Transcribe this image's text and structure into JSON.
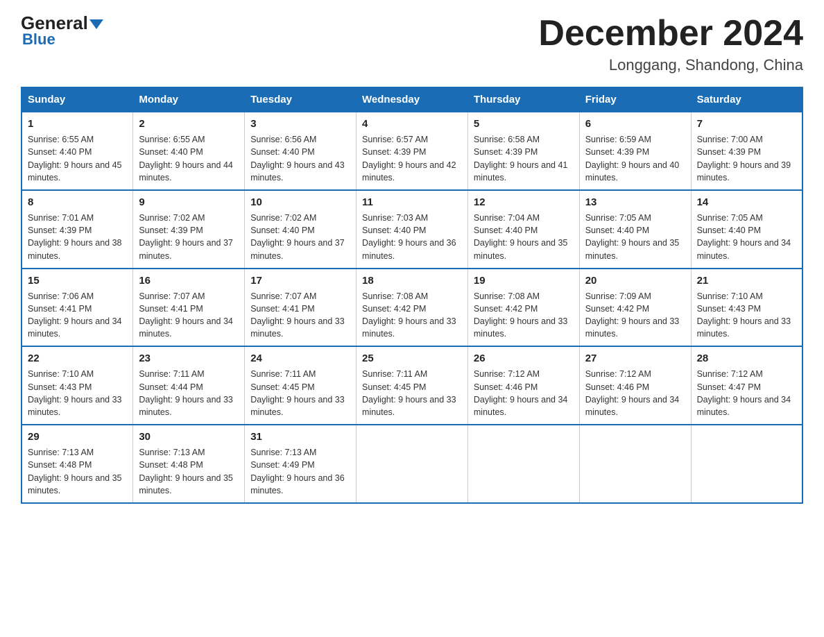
{
  "logo": {
    "general": "General",
    "blue": "Blue",
    "subtitle": "Blue"
  },
  "header": {
    "title": "December 2024",
    "location": "Longgang, Shandong, China"
  },
  "weekdays": [
    "Sunday",
    "Monday",
    "Tuesday",
    "Wednesday",
    "Thursday",
    "Friday",
    "Saturday"
  ],
  "weeks": [
    [
      {
        "day": "1",
        "sunrise": "6:55 AM",
        "sunset": "4:40 PM",
        "daylight": "9 hours and 45 minutes."
      },
      {
        "day": "2",
        "sunrise": "6:55 AM",
        "sunset": "4:40 PM",
        "daylight": "9 hours and 44 minutes."
      },
      {
        "day": "3",
        "sunrise": "6:56 AM",
        "sunset": "4:40 PM",
        "daylight": "9 hours and 43 minutes."
      },
      {
        "day": "4",
        "sunrise": "6:57 AM",
        "sunset": "4:39 PM",
        "daylight": "9 hours and 42 minutes."
      },
      {
        "day": "5",
        "sunrise": "6:58 AM",
        "sunset": "4:39 PM",
        "daylight": "9 hours and 41 minutes."
      },
      {
        "day": "6",
        "sunrise": "6:59 AM",
        "sunset": "4:39 PM",
        "daylight": "9 hours and 40 minutes."
      },
      {
        "day": "7",
        "sunrise": "7:00 AM",
        "sunset": "4:39 PM",
        "daylight": "9 hours and 39 minutes."
      }
    ],
    [
      {
        "day": "8",
        "sunrise": "7:01 AM",
        "sunset": "4:39 PM",
        "daylight": "9 hours and 38 minutes."
      },
      {
        "day": "9",
        "sunrise": "7:02 AM",
        "sunset": "4:39 PM",
        "daylight": "9 hours and 37 minutes."
      },
      {
        "day": "10",
        "sunrise": "7:02 AM",
        "sunset": "4:40 PM",
        "daylight": "9 hours and 37 minutes."
      },
      {
        "day": "11",
        "sunrise": "7:03 AM",
        "sunset": "4:40 PM",
        "daylight": "9 hours and 36 minutes."
      },
      {
        "day": "12",
        "sunrise": "7:04 AM",
        "sunset": "4:40 PM",
        "daylight": "9 hours and 35 minutes."
      },
      {
        "day": "13",
        "sunrise": "7:05 AM",
        "sunset": "4:40 PM",
        "daylight": "9 hours and 35 minutes."
      },
      {
        "day": "14",
        "sunrise": "7:05 AM",
        "sunset": "4:40 PM",
        "daylight": "9 hours and 34 minutes."
      }
    ],
    [
      {
        "day": "15",
        "sunrise": "7:06 AM",
        "sunset": "4:41 PM",
        "daylight": "9 hours and 34 minutes."
      },
      {
        "day": "16",
        "sunrise": "7:07 AM",
        "sunset": "4:41 PM",
        "daylight": "9 hours and 34 minutes."
      },
      {
        "day": "17",
        "sunrise": "7:07 AM",
        "sunset": "4:41 PM",
        "daylight": "9 hours and 33 minutes."
      },
      {
        "day": "18",
        "sunrise": "7:08 AM",
        "sunset": "4:42 PM",
        "daylight": "9 hours and 33 minutes."
      },
      {
        "day": "19",
        "sunrise": "7:08 AM",
        "sunset": "4:42 PM",
        "daylight": "9 hours and 33 minutes."
      },
      {
        "day": "20",
        "sunrise": "7:09 AM",
        "sunset": "4:42 PM",
        "daylight": "9 hours and 33 minutes."
      },
      {
        "day": "21",
        "sunrise": "7:10 AM",
        "sunset": "4:43 PM",
        "daylight": "9 hours and 33 minutes."
      }
    ],
    [
      {
        "day": "22",
        "sunrise": "7:10 AM",
        "sunset": "4:43 PM",
        "daylight": "9 hours and 33 minutes."
      },
      {
        "day": "23",
        "sunrise": "7:11 AM",
        "sunset": "4:44 PM",
        "daylight": "9 hours and 33 minutes."
      },
      {
        "day": "24",
        "sunrise": "7:11 AM",
        "sunset": "4:45 PM",
        "daylight": "9 hours and 33 minutes."
      },
      {
        "day": "25",
        "sunrise": "7:11 AM",
        "sunset": "4:45 PM",
        "daylight": "9 hours and 33 minutes."
      },
      {
        "day": "26",
        "sunrise": "7:12 AM",
        "sunset": "4:46 PM",
        "daylight": "9 hours and 34 minutes."
      },
      {
        "day": "27",
        "sunrise": "7:12 AM",
        "sunset": "4:46 PM",
        "daylight": "9 hours and 34 minutes."
      },
      {
        "day": "28",
        "sunrise": "7:12 AM",
        "sunset": "4:47 PM",
        "daylight": "9 hours and 34 minutes."
      }
    ],
    [
      {
        "day": "29",
        "sunrise": "7:13 AM",
        "sunset": "4:48 PM",
        "daylight": "9 hours and 35 minutes."
      },
      {
        "day": "30",
        "sunrise": "7:13 AM",
        "sunset": "4:48 PM",
        "daylight": "9 hours and 35 minutes."
      },
      {
        "day": "31",
        "sunrise": "7:13 AM",
        "sunset": "4:49 PM",
        "daylight": "9 hours and 36 minutes."
      },
      null,
      null,
      null,
      null
    ]
  ],
  "labels": {
    "sunrise": "Sunrise:",
    "sunset": "Sunset:",
    "daylight": "Daylight:"
  }
}
